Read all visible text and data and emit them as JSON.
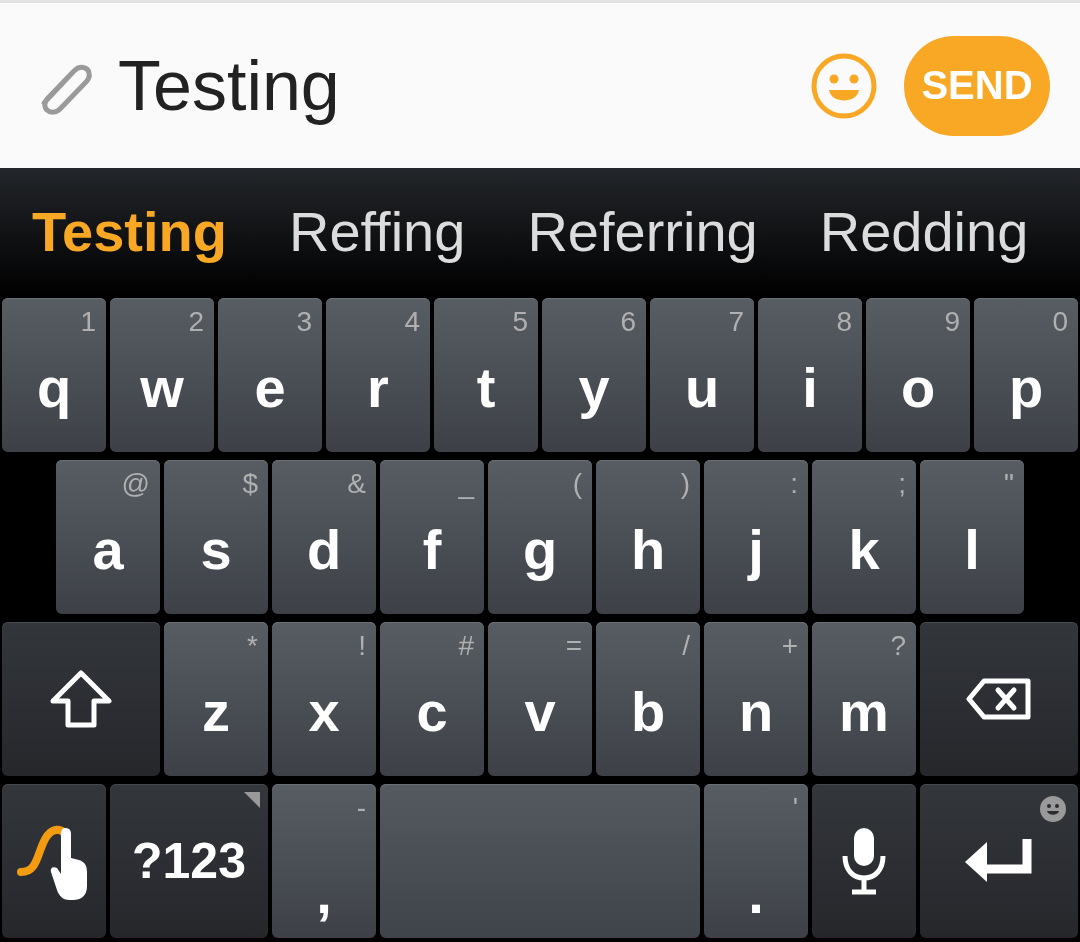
{
  "compose": {
    "value": "Testing",
    "send_label": "SEND"
  },
  "suggestions": [
    {
      "text": "Testing",
      "selected": true
    },
    {
      "text": "Reffing",
      "selected": false
    },
    {
      "text": "Referring",
      "selected": false
    },
    {
      "text": "Redding",
      "selected": false
    }
  ],
  "keyboard": {
    "rows": [
      {
        "keys": [
          {
            "kind": "letter",
            "label": "q",
            "hint": "1"
          },
          {
            "kind": "letter",
            "label": "w",
            "hint": "2"
          },
          {
            "kind": "letter",
            "label": "e",
            "hint": "3"
          },
          {
            "kind": "letter",
            "label": "r",
            "hint": "4"
          },
          {
            "kind": "letter",
            "label": "t",
            "hint": "5"
          },
          {
            "kind": "letter",
            "label": "y",
            "hint": "6"
          },
          {
            "kind": "letter",
            "label": "u",
            "hint": "7"
          },
          {
            "kind": "letter",
            "label": "i",
            "hint": "8"
          },
          {
            "kind": "letter",
            "label": "o",
            "hint": "9"
          },
          {
            "kind": "letter",
            "label": "p",
            "hint": "0"
          }
        ]
      },
      {
        "keys": [
          {
            "kind": "letter",
            "label": "a",
            "hint": "@"
          },
          {
            "kind": "letter",
            "label": "s",
            "hint": "$"
          },
          {
            "kind": "letter",
            "label": "d",
            "hint": "&"
          },
          {
            "kind": "letter",
            "label": "f",
            "hint": "_"
          },
          {
            "kind": "letter",
            "label": "g",
            "hint": "("
          },
          {
            "kind": "letter",
            "label": "h",
            "hint": ")"
          },
          {
            "kind": "letter",
            "label": "j",
            "hint": ":"
          },
          {
            "kind": "letter",
            "label": "k",
            "hint": ";"
          },
          {
            "kind": "letter",
            "label": "l",
            "hint": "\""
          }
        ]
      },
      {
        "keys": [
          {
            "kind": "shift"
          },
          {
            "kind": "letter",
            "label": "z",
            "hint": "*"
          },
          {
            "kind": "letter",
            "label": "x",
            "hint": "!"
          },
          {
            "kind": "letter",
            "label": "c",
            "hint": "#"
          },
          {
            "kind": "letter",
            "label": "v",
            "hint": "="
          },
          {
            "kind": "letter",
            "label": "b",
            "hint": "/"
          },
          {
            "kind": "letter",
            "label": "n",
            "hint": "+"
          },
          {
            "kind": "letter",
            "label": "m",
            "hint": "?"
          },
          {
            "kind": "backspace"
          }
        ]
      },
      {
        "keys": [
          {
            "kind": "swipe"
          },
          {
            "kind": "symbols",
            "label": "?123"
          },
          {
            "kind": "punct",
            "label": ",",
            "hint": "-"
          },
          {
            "kind": "space"
          },
          {
            "kind": "punct",
            "label": ".",
            "hint": "'"
          },
          {
            "kind": "mic"
          },
          {
            "kind": "enter"
          }
        ]
      }
    ]
  }
}
